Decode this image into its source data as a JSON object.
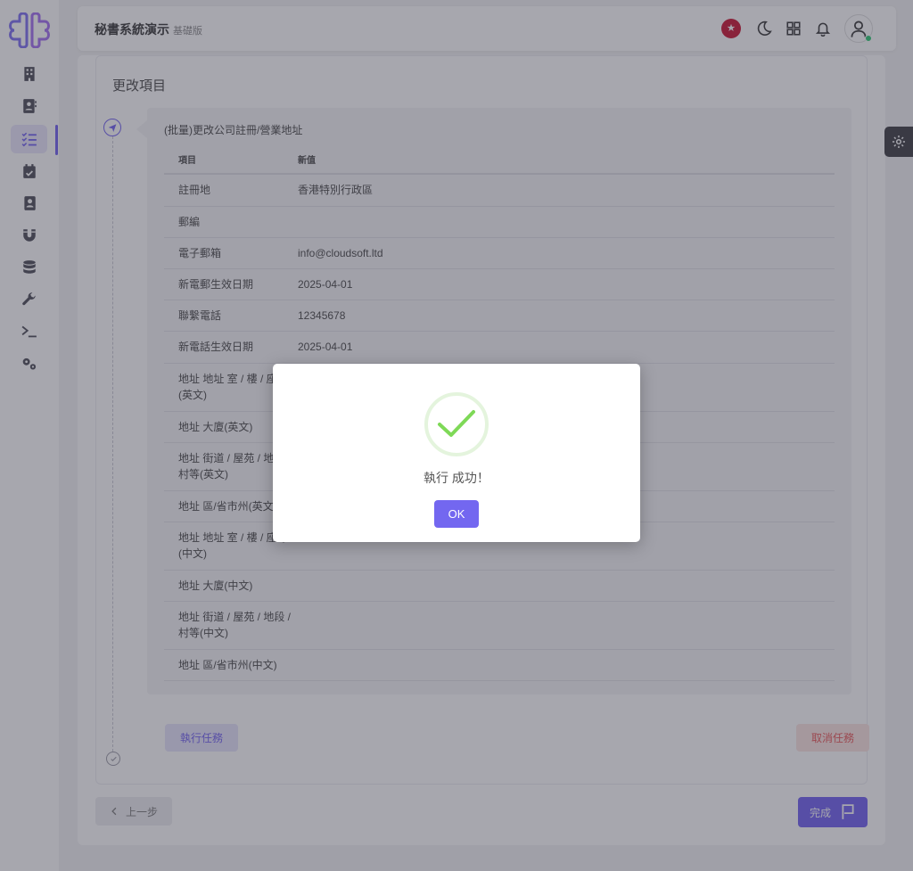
{
  "header": {
    "title": "秘書系統演示",
    "edition": "基礎版"
  },
  "page": {
    "section_title": "更改項目"
  },
  "task": {
    "title": "(批量)更改公司註冊/營業地址",
    "columns": {
      "item": "項目",
      "new_value": "新值"
    },
    "rows": [
      {
        "item": "註冊地",
        "value": "香港特別行政區"
      },
      {
        "item": "郵編",
        "value": ""
      },
      {
        "item": "電子郵箱",
        "value": "info@cloudsoft.ltd"
      },
      {
        "item": "新電郵生效日期",
        "value": "2025-04-01"
      },
      {
        "item": "聯繫電話",
        "value": "12345678"
      },
      {
        "item": "新電話生效日期",
        "value": "2025-04-01"
      },
      {
        "item": "地址 地址 室 / 樓 / 座等(英文)",
        "value": ""
      },
      {
        "item": "地址 大廈(英文)",
        "value": ""
      },
      {
        "item": "地址 街道 / 屋苑 / 地段 / 村等(英文)",
        "value": ""
      },
      {
        "item": "地址 區/省市州(英文)",
        "value": ""
      },
      {
        "item": "地址 地址 室 / 樓 / 座等(中文)",
        "value": ""
      },
      {
        "item": "地址 大廈(中文)",
        "value": ""
      },
      {
        "item": "地址 街道 / 屋苑 / 地段 / 村等(中文)",
        "value": ""
      },
      {
        "item": "地址 區/省市州(中文)",
        "value": ""
      }
    ],
    "run_label": "執行任務",
    "cancel_label": "取消任務"
  },
  "footer": {
    "prev_label": "上一步",
    "done_label": "完成"
  },
  "modal": {
    "message": "執行 成功！",
    "ok_label": "OK"
  },
  "colors": {
    "primary": "#6e5df0",
    "success": "#7ed957",
    "danger": "#ea5455"
  },
  "icons": {
    "sidebar": [
      "building-icon",
      "contact-book-icon",
      "task-list-icon",
      "calendar-check-icon",
      "address-book-icon",
      "magnet-icon",
      "database-icon",
      "wrench-icon",
      "terminal-icon",
      "gears-icon"
    ],
    "header": [
      "hk-flag-icon",
      "moon-icon",
      "grid-icon",
      "bell-icon",
      "user-icon"
    ]
  }
}
